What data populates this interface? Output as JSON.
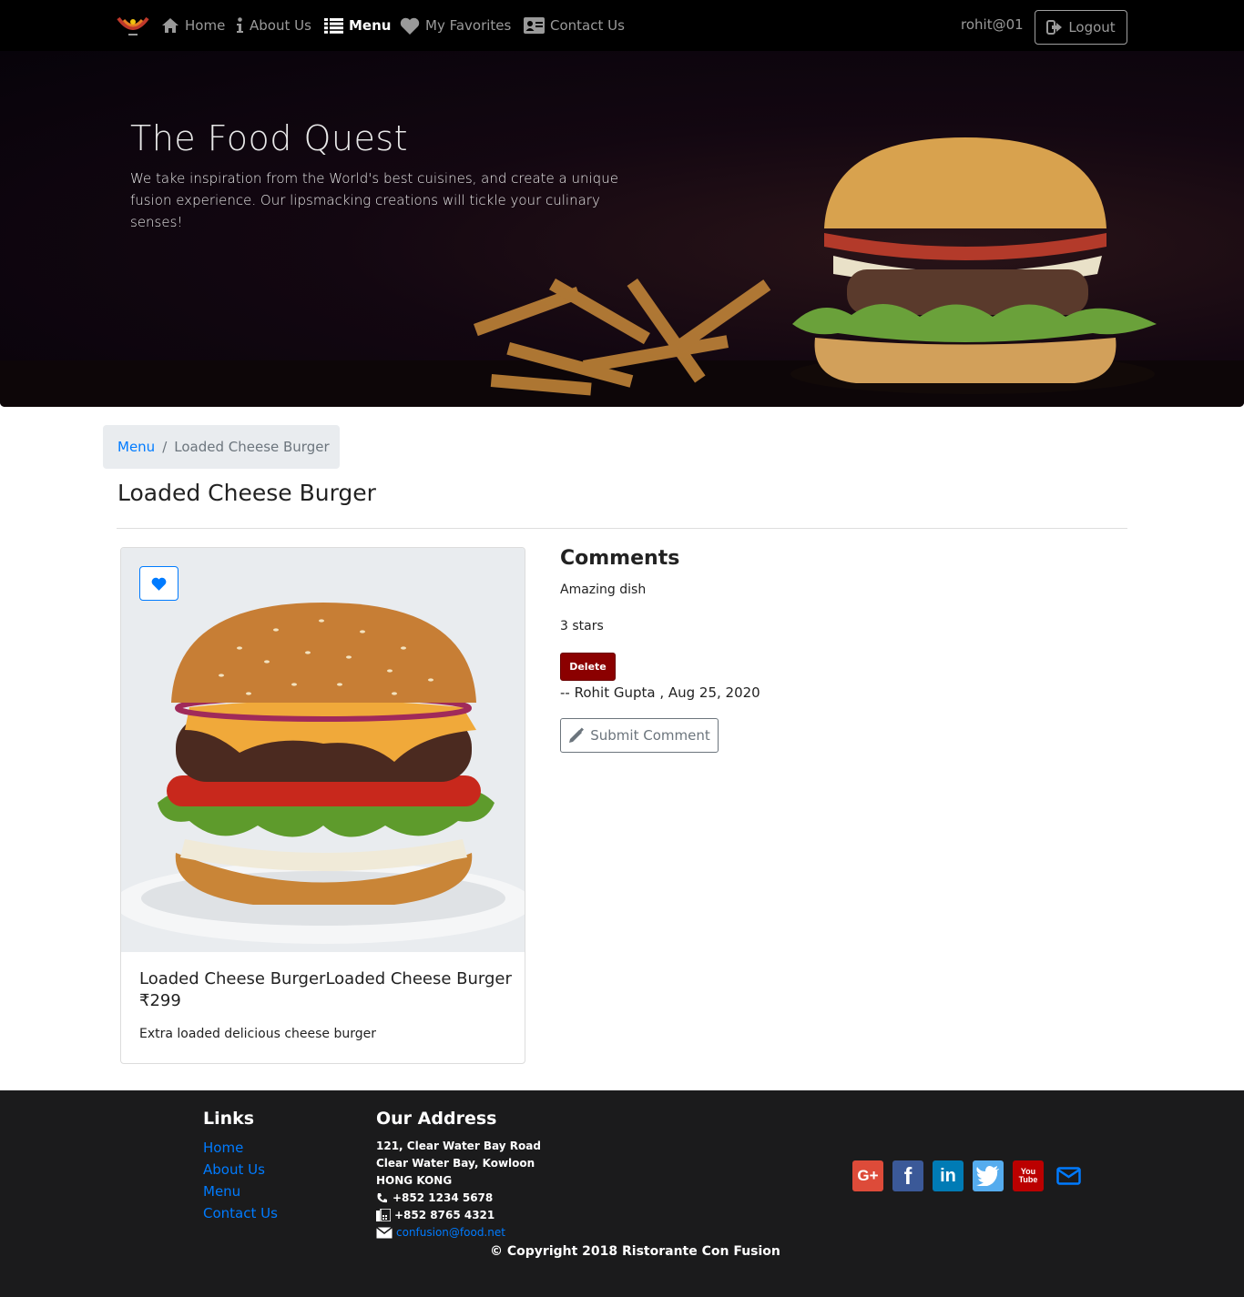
{
  "nav": {
    "items": [
      {
        "label": "Home",
        "icon": "home-icon"
      },
      {
        "label": "About Us",
        "icon": "info-icon"
      },
      {
        "label": "Menu",
        "icon": "list-icon"
      },
      {
        "label": "My Favorites",
        "icon": "heart-icon"
      },
      {
        "label": "Contact Us",
        "icon": "address-card-icon"
      }
    ],
    "active": "Menu",
    "user": "rohit@01",
    "logout_label": "Logout"
  },
  "hero": {
    "title": "The Food Quest",
    "text": "We take inspiration from the World's best cuisines, and create a unique fusion experience. Our lipsmacking creations will tickle your culinary senses!"
  },
  "breadcrumb": {
    "link": "Menu",
    "separator": "/",
    "current": "Loaded Cheese Burger"
  },
  "page_title": "Loaded Cheese Burger",
  "dish": {
    "title": "Loaded Cheese BurgerLoaded Cheese Burger  ₹299",
    "description": "Extra loaded delicious cheese burger"
  },
  "comments": {
    "heading": "Comments",
    "items": [
      {
        "text": "Amazing dish",
        "rating": "3 stars",
        "delete_label": "Delete",
        "byline": "-- Rohit Gupta , Aug 25, 2020"
      }
    ],
    "submit_label": "Submit Comment"
  },
  "footer": {
    "links_heading": "Links",
    "links": [
      "Home",
      "About Us",
      "Menu",
      "Contact Us"
    ],
    "address_heading": "Our Address",
    "address_lines": [
      "121, Clear Water Bay Road",
      "Clear Water Bay, Kowloon",
      "HONG KONG"
    ],
    "phone": "+852 1234 5678",
    "fax": "+852 8765 4321",
    "email": "confusion@food.net",
    "copyright": "© Copyright 2018 Ristorante Con Fusion",
    "social": [
      {
        "name": "google-plus",
        "glyph": "G+",
        "color": "#dd4b39"
      },
      {
        "name": "facebook",
        "glyph": "f",
        "color": "#3b5998"
      },
      {
        "name": "linkedin",
        "glyph": "in",
        "color": "#007bb5"
      },
      {
        "name": "twitter",
        "glyph": "t",
        "color": "#55acee"
      },
      {
        "name": "youtube",
        "glyph": "You Tube",
        "color": "#bb0000"
      }
    ]
  },
  "colors": {
    "link": "#007bff",
    "delete": "#8b0000",
    "footer_bg": "#1b1b1c",
    "nav_bg": "#000000"
  }
}
